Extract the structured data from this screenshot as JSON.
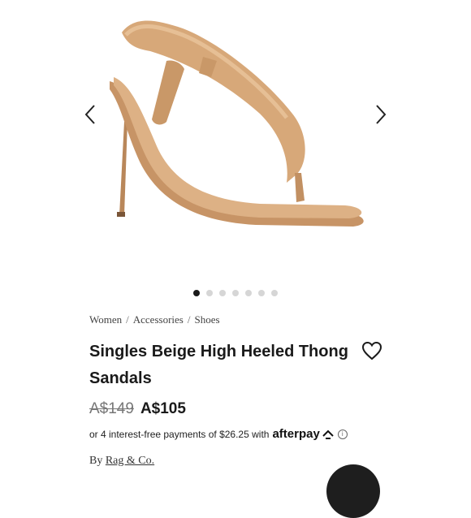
{
  "gallery": {
    "image_alt": "Singles Beige High Heeled Thong Sandals",
    "image_count": 7,
    "active_index": 0,
    "prev_icon": "chevron-left-icon",
    "next_icon": "chevron-right-icon"
  },
  "breadcrumb": {
    "items": [
      "Women",
      "Accessories",
      "Shoes"
    ],
    "separator": "/"
  },
  "product": {
    "title": "Singles Beige High Heeled Thong Sandals",
    "original_price": "A$149",
    "sale_price": "A$105",
    "installments_text": "or 4 interest-free payments of $26.25 with",
    "afterpay_label": "afterpay",
    "info_glyph": "i",
    "brand_prefix": "By",
    "brand_name": "Rag & Co.",
    "wishlist_icon": "heart-icon"
  },
  "colors": {
    "sandal": "#d7a879",
    "sandal_shadow": "#b9875a",
    "active_dot": "#1a1a1a",
    "inactive_dot": "#d6d6d6"
  }
}
